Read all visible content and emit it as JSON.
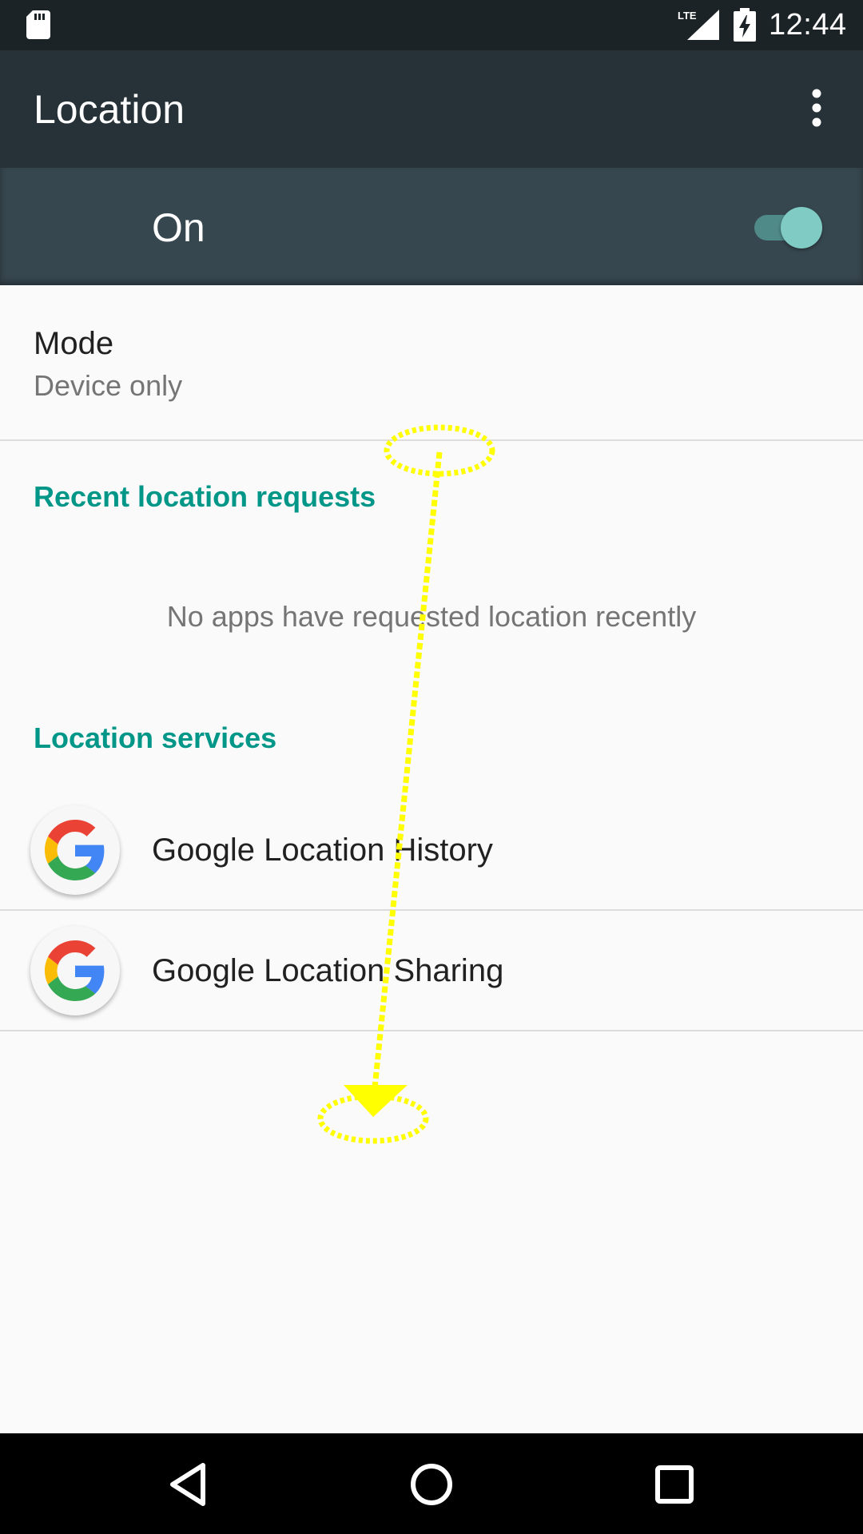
{
  "status_bar": {
    "time": "12:44",
    "network_label": "LTE",
    "icons": [
      "sd-card-icon",
      "lte-signal-icon",
      "battery-charging-icon"
    ]
  },
  "app_bar": {
    "title": "Location",
    "overflow_icon": "more-vert-icon"
  },
  "master_switch": {
    "label": "On",
    "state": "on",
    "accent_color": "#80cbc4"
  },
  "mode": {
    "title": "Mode",
    "summary": "Device only"
  },
  "recent_requests": {
    "header": "Recent location requests",
    "empty_text": "No apps have requested location recently"
  },
  "location_services": {
    "header": "Location services",
    "items": [
      {
        "label": "Google Location History",
        "icon": "google-g-icon"
      },
      {
        "label": "Google Location Sharing",
        "icon": "google-g-icon"
      }
    ]
  },
  "gesture_annotation": {
    "type": "swipe",
    "direction": "down",
    "color": "#ffff00"
  },
  "nav_bar": {
    "buttons": [
      "back-icon",
      "home-icon",
      "recents-icon"
    ]
  },
  "colors": {
    "status_bar": "#1c2327",
    "app_bar": "#263238",
    "switch_bar": "#37474f",
    "section_header": "#009688",
    "background": "#fafafa"
  }
}
